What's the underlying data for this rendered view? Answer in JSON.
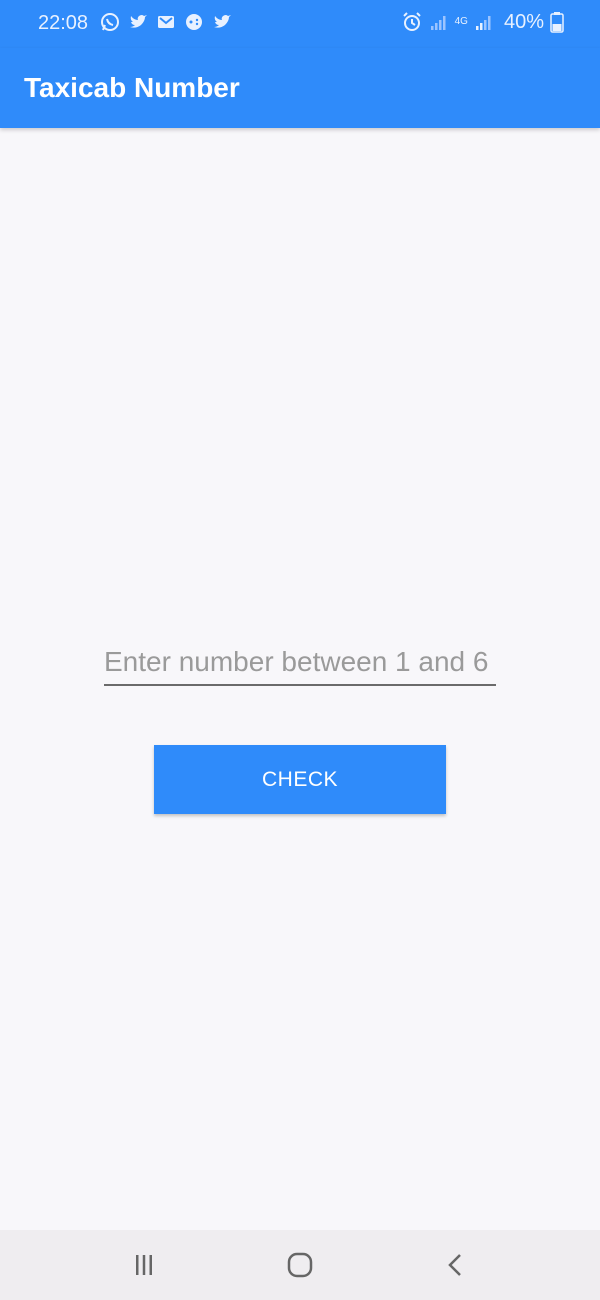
{
  "status_bar": {
    "time": "22:08",
    "battery": "40%",
    "network": "4G",
    "notification_icons": [
      "whatsapp-icon",
      "twitter-icon",
      "gmail-icon",
      "game-icon",
      "twitter-icon"
    ],
    "system_icons": [
      "alarm-icon",
      "signal-icon",
      "signal-icon",
      "battery-icon"
    ]
  },
  "app_bar": {
    "title": "Taxicab Number"
  },
  "form": {
    "input_placeholder": "Enter number between 1 and 6",
    "input_value": "",
    "check_label": "CHECK"
  },
  "nav_bar": {
    "buttons": [
      "recent-apps",
      "home",
      "back"
    ]
  },
  "colors": {
    "primary": "#2f8bfa",
    "background": "#f8f7fa",
    "nav_background": "#efedf0"
  }
}
